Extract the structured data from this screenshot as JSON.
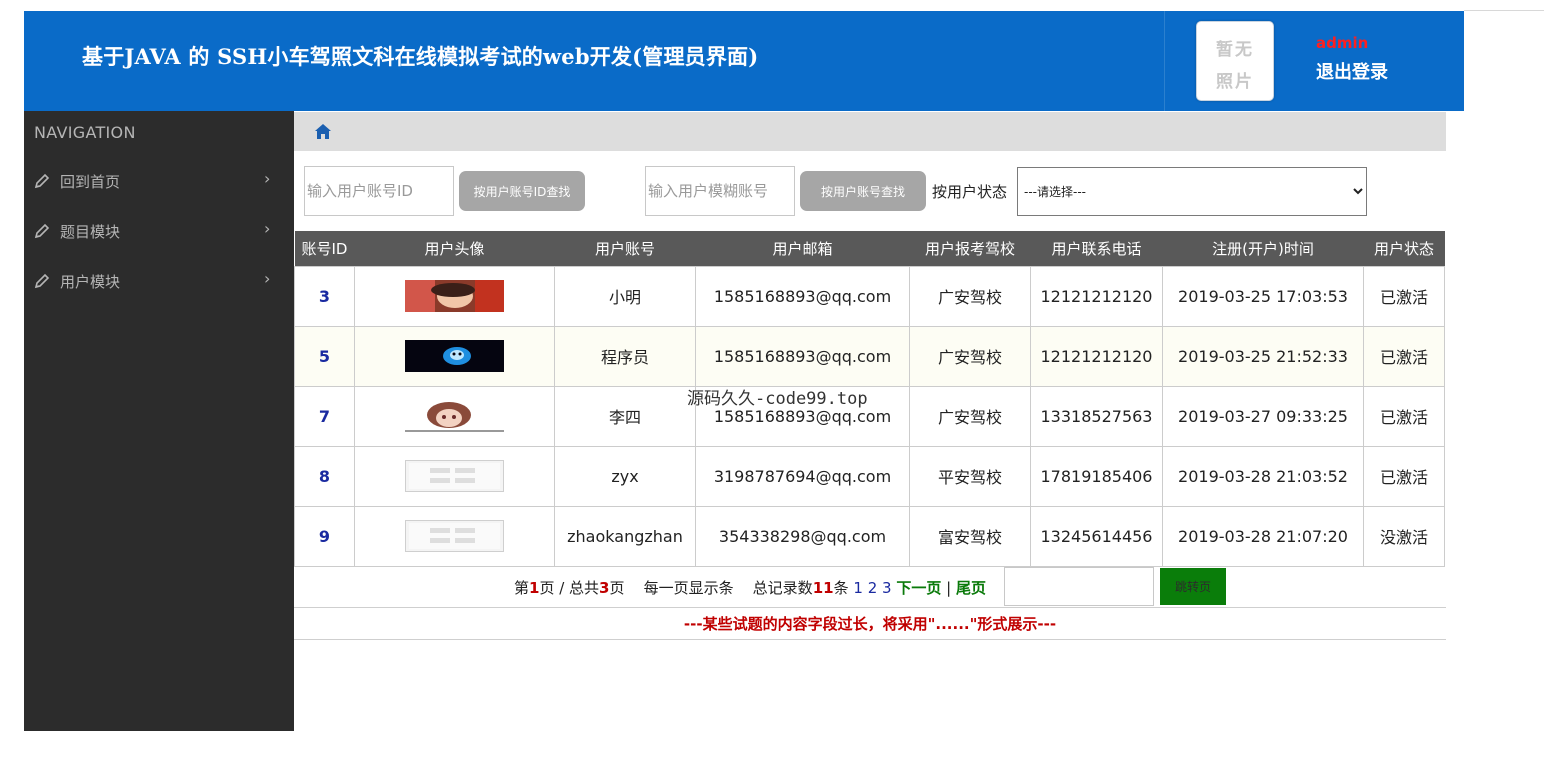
{
  "header": {
    "title": "基于JAVA 的 SSH小车驾照文科在线模拟考试的web开发(管理员界面)",
    "photo_placeholder_line1": "暂无",
    "photo_placeholder_line2": "照片",
    "user_name": "admin",
    "logout_label": "退出登录"
  },
  "sidebar": {
    "title": "NAVIGATION",
    "items": [
      {
        "label": "回到首页",
        "icon": "pencil-icon"
      },
      {
        "label": "题目模块",
        "icon": "pencil-icon"
      },
      {
        "label": "用户模块",
        "icon": "pencil-icon"
      }
    ],
    "chevron": "›"
  },
  "breadcrumb": {
    "icon": "home-icon"
  },
  "search": {
    "id_placeholder": "输入用户账号ID",
    "id_button": "按用户账号ID查找",
    "account_placeholder": "输入用户模糊账号",
    "account_button": "按用户账号查找",
    "status_label": "按用户状态",
    "status_selected": "---请选择---"
  },
  "table": {
    "headers": [
      "账号ID",
      "用户头像",
      "用户账号",
      "用户邮箱",
      "用户报考驾校",
      "用户联系电话",
      "注册(开户)时间",
      "用户状态"
    ],
    "rows": [
      {
        "id": "3",
        "avatar": "avatar-photo-red",
        "account": "小明",
        "email": "1585168893@qq.com",
        "school": "广安驾校",
        "phone": "12121212120",
        "registered": "2019-03-25 17:03:53",
        "status": "已激活"
      },
      {
        "id": "5",
        "avatar": "avatar-photo-blue",
        "account": "程序员",
        "email": "1585168893@qq.com",
        "school": "广安驾校",
        "phone": "12121212120",
        "registered": "2019-03-25 21:52:33",
        "status": "已激活"
      },
      {
        "id": "7",
        "avatar": "avatar-photo-girl",
        "account": "李四",
        "email": "1585168893@qq.com",
        "school": "广安驾校",
        "phone": "13318527563",
        "registered": "2019-03-27 09:33:25",
        "status": "已激活"
      },
      {
        "id": "8",
        "avatar": "avatar-placeholder",
        "account": "zyx",
        "email": "3198787694@qq.com",
        "school": "平安驾校",
        "phone": "17819185406",
        "registered": "2019-03-28 21:03:52",
        "status": "已激活"
      },
      {
        "id": "9",
        "avatar": "avatar-placeholder",
        "account": "zhaokangzhan",
        "email": "354338298@qq.com",
        "school": "富安驾校",
        "phone": "13245614456",
        "registered": "2019-03-28 21:07:20",
        "status": "没激活"
      }
    ]
  },
  "pager": {
    "prefix": "第",
    "current": "1",
    "mid": "页 / 总共",
    "total_pages": "3",
    "suffix": "页",
    "per_page": "每一页显示条",
    "total_prefix": "总记录数",
    "total_records": "11",
    "total_suffix": "条",
    "pages": [
      "1",
      "2",
      "3"
    ],
    "next": "下一页",
    "separator": "|",
    "last": "尾页",
    "jump_button": "跳转页"
  },
  "notice": "---某些试题的内容字段过长，将采用\"......\"形式展示---",
  "watermark": "源码久久-code99.top",
  "colors": {
    "header_bg": "#0a6bc8",
    "sidebar_bg": "#2c2c2c",
    "table_header_bg": "#595959",
    "id_text": "#1a2aa0",
    "accent_red": "#c00000",
    "jump_button_bg": "#0a7d0a"
  }
}
